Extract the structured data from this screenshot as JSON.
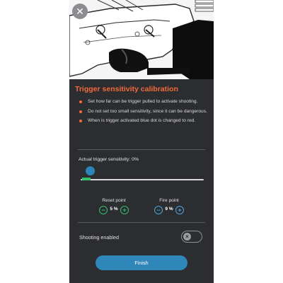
{
  "hero": {
    "image_name": "rifle-lower-receiver-diagram",
    "close_icon": "close-icon"
  },
  "calibration": {
    "title": "Trigger sensitivity calibration",
    "bullets": [
      "Set how far can be trigger pulled to activate shooting.",
      "Do not set too small sensitivity, since it can be dangerous.",
      "When is trigger activated blue dot is changed to red."
    ],
    "sensitivity_label": "Actual trigger sensitivity: 0%",
    "sensitivity_value_percent": 0,
    "reset_point": {
      "label": "Reset point",
      "value": "5 %",
      "value_fraction": 0.05
    },
    "fire_point": {
      "label": "Fire point",
      "value": "9 %",
      "value_fraction": 0.09
    },
    "shooting": {
      "label": "Shooting enabled",
      "enabled": false
    },
    "finish_label": "Finish"
  },
  "colors": {
    "accent_orange": "#f26b3a",
    "primary_blue": "#2f86b9",
    "indicator_green": "#35c06a",
    "background": "#2b2d31"
  }
}
